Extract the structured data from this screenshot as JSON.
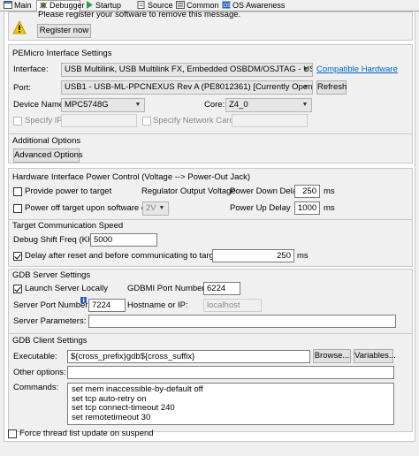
{
  "tabs": [
    {
      "label": "Main",
      "icon": "main-tab-icon"
    },
    {
      "label": "Debugger",
      "icon": "debugger-bug-icon"
    },
    {
      "label": "Startup",
      "icon": "startup-play-icon"
    },
    {
      "label": "Source",
      "icon": "source-icon"
    },
    {
      "label": "Common",
      "icon": "common-icon"
    },
    {
      "label": "OS Awareness",
      "icon": "os-awareness-icon"
    }
  ],
  "register": {
    "message": "Please register your software to remove this message.",
    "button": "Register now"
  },
  "pemicro": {
    "title": "PEMicro Interface Settings",
    "interface_label": "Interface:",
    "interface_value": "USB Multilink, USB Multilink FX, Embedded OSBDM/OSJTAG - USB Port",
    "compat_link": "Compatible Hardware",
    "port_label": "Port:",
    "port_value": "USB1 - USB-ML-PPCNEXUS Rev A (PE8012361) [Currently Open]",
    "refresh": "Refresh",
    "device_label": "Device Name:",
    "device_value": "MPC5748G",
    "core_label": "Core:",
    "core_value": "Z4_0",
    "specify_ip": "Specify IP",
    "specify_nic": "Specify Network Card IP"
  },
  "additional": {
    "title": "Additional Options",
    "button": "Advanced Options"
  },
  "power": {
    "title": "Hardware Interface Power Control (Voltage --> Power-Out Jack)",
    "provide": "Provide power to target",
    "regulator": "Regulator Output Voltage",
    "down_label": "Power Down Delay",
    "down_value": "250",
    "ms1": "ms",
    "off_exit": "Power off target upon software exit",
    "voltage": "2V",
    "up_label": "Power Up Delay",
    "up_value": "1000",
    "ms2": "ms"
  },
  "comm": {
    "title": "Target Communication Speed",
    "shift_label": "Debug Shift Freq (KHz)",
    "shift_value": "5000",
    "delay_label": "Delay after reset and before communicating to target for",
    "delay_value": "250",
    "ms": "ms"
  },
  "gdb_server": {
    "title": "GDB Server Settings",
    "launch": "Launch Server Locally",
    "gdbmi_label": "GDBMI Port Number:",
    "gdbmi_value": "6224",
    "port_label": "Server Port Number:",
    "port_value": "7224",
    "host_label": "Hostname or IP:",
    "host_value": "localhost",
    "params_label": "Server Parameters:",
    "params_value": ""
  },
  "gdb_client": {
    "title": "GDB Client Settings",
    "exe_label": "Executable:",
    "exe_value": "${cross_prefix}gdb${cross_suffix}",
    "browse": "Browse...",
    "variables": "Variables...",
    "other_label": "Other options:",
    "other_value": "",
    "cmd_label": "Commands:",
    "commands": [
      "set mem inaccessible-by-default off",
      "set tcp auto-retry on",
      "set tcp connect-timeout 240",
      "set remotetimeout 30"
    ]
  },
  "force_thread": "Force thread list update on suspend",
  "colors": {
    "link": "#0066cc",
    "warning": "#f5c400"
  }
}
